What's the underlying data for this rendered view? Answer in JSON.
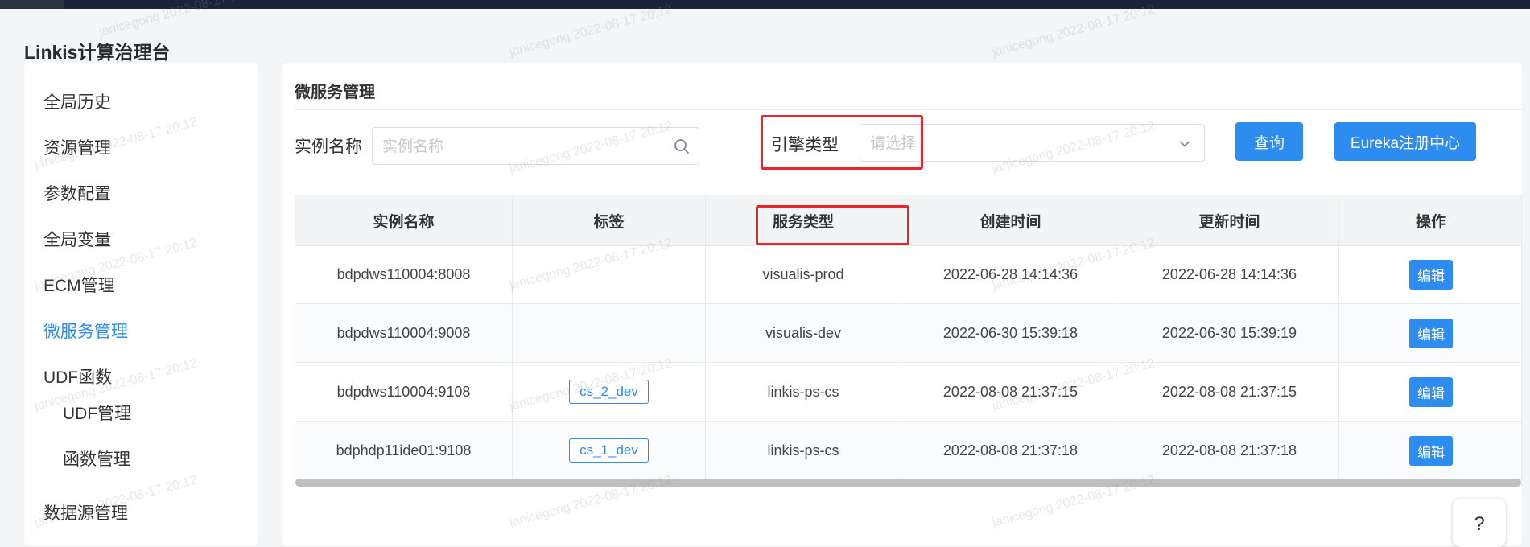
{
  "app": {
    "title": "Linkis计算治理台"
  },
  "sidebar": {
    "items": [
      {
        "label": "全局历史",
        "active": false
      },
      {
        "label": "资源管理",
        "active": false
      },
      {
        "label": "参数配置",
        "active": false
      },
      {
        "label": "全局变量",
        "active": false
      },
      {
        "label": "ECM管理",
        "active": false
      },
      {
        "label": "微服务管理",
        "active": true
      },
      {
        "label": "UDF函数",
        "active": false
      },
      {
        "label": "UDF管理",
        "active": false
      },
      {
        "label": "函数管理",
        "active": false
      },
      {
        "label": "数据源管理",
        "active": false
      }
    ]
  },
  "page": {
    "title": "微服务管理"
  },
  "filters": {
    "instance_label": "实例名称",
    "instance_placeholder": "实例名称",
    "engine_label": "引擎类型",
    "engine_placeholder": "请选择",
    "query_button": "查询",
    "eureka_button": "Eureka注册中心"
  },
  "table": {
    "columns": [
      "实例名称",
      "标签",
      "服务类型",
      "创建时间",
      "更新时间",
      "操作"
    ],
    "rows": [
      {
        "instance": "bdpdws110004:8008",
        "tag": "",
        "service": "visualis-prod",
        "created": "2022-06-28 14:14:36",
        "updated": "2022-06-28 14:14:36",
        "action": "编辑"
      },
      {
        "instance": "bdpdws110004:9008",
        "tag": "",
        "service": "visualis-dev",
        "created": "2022-06-30 15:39:18",
        "updated": "2022-06-30 15:39:19",
        "action": "编辑"
      },
      {
        "instance": "bdpdws110004:9108",
        "tag": "cs_2_dev",
        "service": "linkis-ps-cs",
        "created": "2022-08-08 21:37:15",
        "updated": "2022-08-08 21:37:15",
        "action": "编辑"
      },
      {
        "instance": "bdphdp11ide01:9108",
        "tag": "cs_1_dev",
        "service": "linkis-ps-cs",
        "created": "2022-08-08 21:37:18",
        "updated": "2022-08-08 21:37:18",
        "action": "编辑"
      }
    ]
  },
  "help": {
    "label": "?"
  },
  "watermark": {
    "text": "janicegong 2022-08-17 20:12"
  },
  "colors": {
    "primary": "#2d8cf0",
    "highlight_box": "#e8262a",
    "topbar": "#1c2438"
  },
  "icons": {
    "search": "search-icon",
    "dropdown": "chevron-down-icon"
  }
}
